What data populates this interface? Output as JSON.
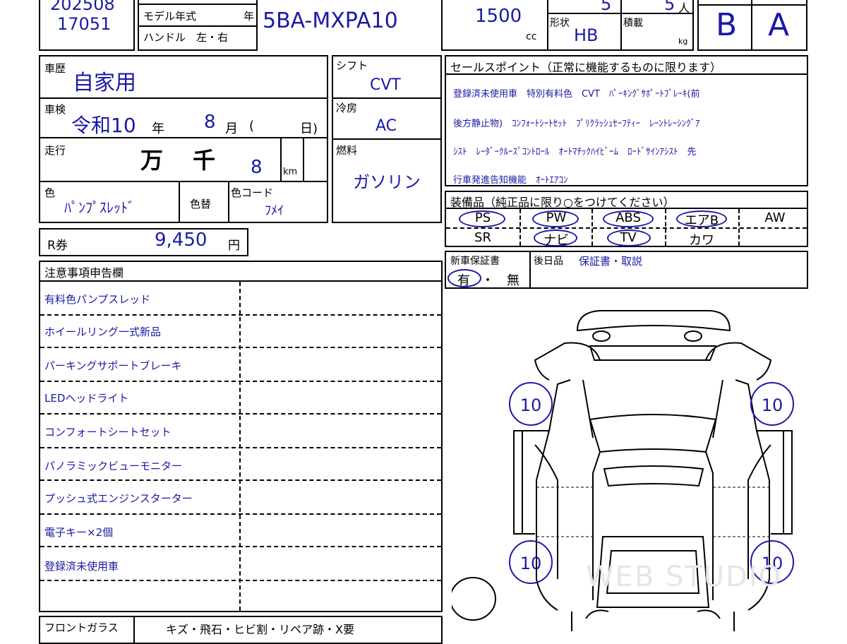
{
  "header": {
    "lot_top": "202508",
    "lot_number": "17051",
    "model_year_label": "モデル年式",
    "year_unit": "年",
    "handle_label": "ハンドル　左・右",
    "model_code": "5BA-MXPA10",
    "displacement": "1500",
    "cc_unit": "cc",
    "doors": "5",
    "capacity": "5",
    "capacity_unit": "人",
    "shape_label": "形状",
    "shape_value": "HB",
    "load_label": "積載",
    "load_unit": "kg",
    "grade_exterior": "B",
    "grade_interior": "A"
  },
  "history": {
    "label": "車歴",
    "value": "自家用"
  },
  "inspection": {
    "label": "車検",
    "era": "令和10",
    "year_unit": "年",
    "month": "8",
    "month_unit": "月",
    "paren_open": "(",
    "day_unit": "日)"
  },
  "mileage": {
    "label": "走行",
    "man": "万",
    "sen": "千",
    "value": "8",
    "unit": "km"
  },
  "color": {
    "label": "色",
    "value": "ﾊﾟﾝﾌﾟｽﾚｯﾄﾞ",
    "repaint_label": "色替",
    "code_label": "色コード",
    "code_value": "ﾌﾒｲ"
  },
  "shift": {
    "label": "シフト",
    "value": "CVT"
  },
  "aircon": {
    "label": "冷房",
    "value": "AC"
  },
  "fuel": {
    "label": "燃料",
    "value": "ガソリン"
  },
  "recycle": {
    "label": "R券",
    "value": "9,450",
    "unit": "円"
  },
  "sales_points": {
    "title": "セールスポイント（正常に機能するものに限ります）",
    "lines": [
      "登録済未使用車　特別有料色　CVT　ﾊﾟｰｷﾝｸﾞｻﾎﾟｰﾄﾌﾞﾚｰｷ(前",
      "後方静止物)　ｺﾝﾌｫｰﾄｼｰﾄｾｯﾄ　ﾌﾟﾘｸﾗｯｼｭｾｰﾌﾃｨｰ　ﾚｰﾝﾄﾚｰｼﾝｸﾞｱ",
      "ｼｽﾄ　ﾚｰﾀﾞｰｸﾙｰｽﾞｺﾝﾄﾛｰﾙ　ｵｰﾄﾏﾁｯｸﾊｲﾋﾞｰﾑ　ﾛｰﾄﾞｻｲﾝｱｼｽﾄ　先",
      "行車発進告知機能　ｵｰﾄｴｱｺﾝ"
    ]
  },
  "equipment": {
    "title": "装備品（純正品に限り○をつけてください）",
    "row1": [
      "PS",
      "PW",
      "ABS",
      "エアB",
      "AW"
    ],
    "row2": [
      "SR",
      "ナビ",
      "TV",
      "カワ"
    ]
  },
  "warranty": {
    "label": "新車保証書",
    "yes": "有",
    "dot": "・",
    "no": "無",
    "after_label": "後日品",
    "after_value": "保証書・取説"
  },
  "notes": {
    "title": "注意事項申告欄",
    "items": [
      "有料色パンプスレッド",
      "ホイールリング一式新品",
      "パーキングサポートブレーキ",
      "LEDヘッドライト",
      "コンフォートシートセット",
      "パノラミックビューモニター",
      "プッシュ式エンジンスターター",
      "電子キー×2個",
      "登録済未使用車",
      ""
    ]
  },
  "windshield": {
    "label": "フロントガラス",
    "options": "キズ・飛石・ヒビ割・リペア跡・X要"
  },
  "tires": {
    "front_left": "10",
    "front_right": "10",
    "rear_left": "10",
    "rear_right": "10"
  },
  "watermark": "WEB STUDIO"
}
